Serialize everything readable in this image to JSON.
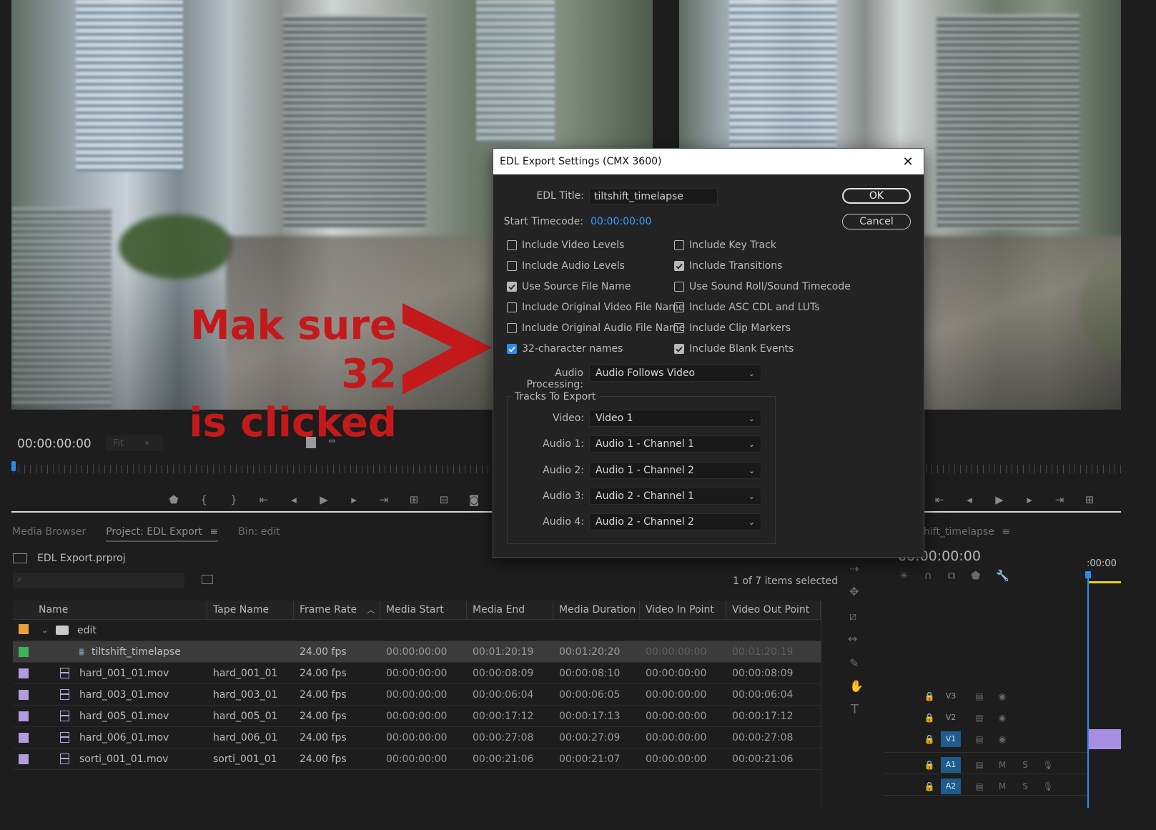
{
  "annotation": {
    "line1": "Mak sure 32",
    "line2": "is clicked"
  },
  "monitor": {
    "timecode": "00:00:00:00",
    "fit": "Fit"
  },
  "panels": {
    "tabs": [
      "Media Browser",
      "Project: EDL Export",
      "Bin: edit"
    ]
  },
  "project": {
    "file": "EDL Export.prproj",
    "search_placeholder": "",
    "selection": "1 of 7 items selected",
    "columns": [
      "Name",
      "Tape Name",
      "Frame Rate",
      "Media Start",
      "Media End",
      "Media Duration",
      "Video In Point",
      "Video Out Point"
    ],
    "bin": {
      "name": "edit",
      "color": "#e8a33c"
    },
    "rows": [
      {
        "name": "tiltshift_timelapse",
        "tape": "",
        "fps": "24.00 fps",
        "start": "00:00:00:00",
        "end": "00:01:20:19",
        "dur": "00:01:20:20",
        "in": "00:00:00:00",
        "out": "00:01:20:19",
        "color": "#3fb35b",
        "selected": true
      },
      {
        "name": "hard_001_01.mov",
        "tape": "hard_001_01",
        "fps": "24.00 fps",
        "start": "00:00:00:00",
        "end": "00:00:08:09",
        "dur": "00:00:08:10",
        "in": "00:00:00:00",
        "out": "00:00:08:09",
        "color": "#b19ce0"
      },
      {
        "name": "hard_003_01.mov",
        "tape": "hard_003_01",
        "fps": "24.00 fps",
        "start": "00:00:00:00",
        "end": "00:00:06:04",
        "dur": "00:00:06:05",
        "in": "00:00:00:00",
        "out": "00:00:06:04",
        "color": "#b19ce0"
      },
      {
        "name": "hard_005_01.mov",
        "tape": "hard_005_01",
        "fps": "24.00 fps",
        "start": "00:00:00:00",
        "end": "00:00:17:12",
        "dur": "00:00:17:13",
        "in": "00:00:00:00",
        "out": "00:00:17:12",
        "color": "#b19ce0"
      },
      {
        "name": "hard_006_01.mov",
        "tape": "hard_006_01",
        "fps": "24.00 fps",
        "start": "00:00:00:00",
        "end": "00:00:27:08",
        "dur": "00:00:27:09",
        "in": "00:00:00:00",
        "out": "00:00:27:08",
        "color": "#b19ce0"
      },
      {
        "name": "sorti_001_01.mov",
        "tape": "sorti_001_01",
        "fps": "24.00 fps",
        "start": "00:00:00:00",
        "end": "00:00:21:06",
        "dur": "00:00:21:07",
        "in": "00:00:00:00",
        "out": "00:00:21:06",
        "color": "#b19ce0"
      }
    ]
  },
  "timeline": {
    "tab": "hift_timelapse",
    "timecode": "00:00:00:00",
    "ruler_label": ":00:00",
    "tracks": [
      "V3",
      "V2",
      "V1",
      "A1",
      "A2"
    ],
    "mute": "M",
    "solo": "S"
  },
  "dialog": {
    "title": "EDL Export Settings (CMX 3600)",
    "close": "✕",
    "edl_title_label": "EDL Title:",
    "edl_title_value": "tiltshift_timelapse",
    "start_tc_label": "Start Timecode:",
    "start_tc_value": "00:00:00:00",
    "ok": "OK",
    "cancel": "Cancel",
    "checks_left": [
      {
        "label": "Include Video Levels",
        "checked": false
      },
      {
        "label": "Include Audio Levels",
        "checked": false
      },
      {
        "label": "Use Source File Name",
        "checked": true
      },
      {
        "label": "Include Original Video File Name",
        "checked": false
      },
      {
        "label": "Include Original Audio File Name",
        "checked": false
      },
      {
        "label": "32-character names",
        "checked": true,
        "highlight": true
      }
    ],
    "checks_right": [
      {
        "label": "Include Key Track",
        "checked": false
      },
      {
        "label": "Include Transitions",
        "checked": true
      },
      {
        "label": "Use Sound Roll/Sound Timecode",
        "checked": false
      },
      {
        "label": "Include ASC CDL and LUTs",
        "checked": false
      },
      {
        "label": "Include Clip Markers",
        "checked": false
      },
      {
        "label": "Include Blank Events",
        "checked": true
      }
    ],
    "audio_processing_label": "Audio Processing:",
    "audio_processing_value": "Audio Follows Video",
    "tracks_legend": "Tracks To Export",
    "tracks": [
      {
        "label": "Video:",
        "value": "Video 1"
      },
      {
        "label": "Audio 1:",
        "value": "Audio 1 - Channel 1"
      },
      {
        "label": "Audio 2:",
        "value": "Audio 1 - Channel 2"
      },
      {
        "label": "Audio 3:",
        "value": "Audio 2 - Channel 1"
      },
      {
        "label": "Audio 4:",
        "value": "Audio 2 - Channel 2"
      }
    ]
  },
  "colors": {
    "accent": "#2d8ceb",
    "annotation": "#c4191b",
    "track_on": "#1f5c8c"
  }
}
